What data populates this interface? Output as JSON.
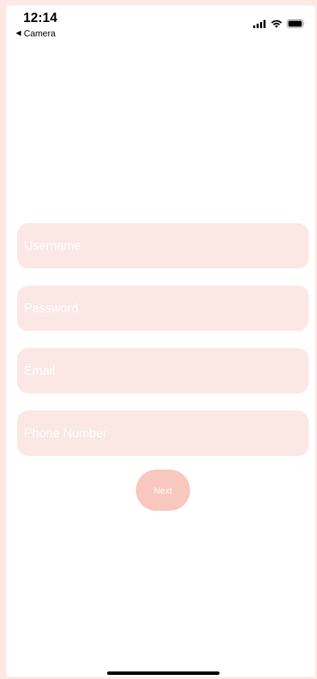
{
  "status_bar": {
    "time": "12:14",
    "back_app": "Camera",
    "back_icon": "back-triangle-icon",
    "icons": [
      "cellular-signal-icon",
      "wifi-icon",
      "battery-icon"
    ]
  },
  "form": {
    "username_placeholder": "Username",
    "password_placeholder": "Password",
    "email_placeholder": "Email",
    "phone_placeholder": "Phone Number",
    "username_value": "",
    "password_value": "",
    "email_value": "",
    "phone_value": "",
    "next_label": "Next"
  },
  "colors": {
    "page_border": "#fde8e3",
    "field_bg": "#fbe7e3",
    "button_bg": "#f8c7be",
    "placeholder": "#ffffff"
  }
}
